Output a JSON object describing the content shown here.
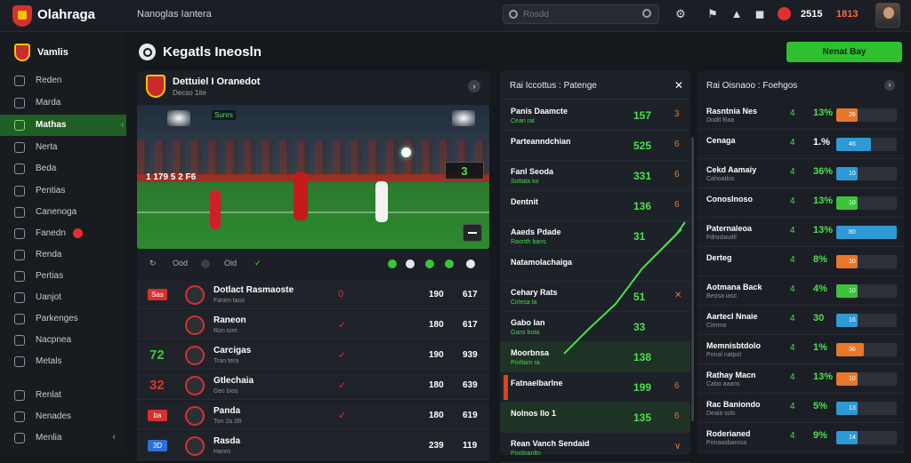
{
  "app": {
    "brand": "Olahraga",
    "topnav": "Nanoglas Iantera",
    "balance": "2515",
    "balance_sub": "1813"
  },
  "search": {
    "placeholder": "Rosdd"
  },
  "sidebar": {
    "header": "Vamlis",
    "items": [
      {
        "label": "Reden",
        "active": false
      },
      {
        "label": "Marda",
        "active": false
      },
      {
        "label": "Mathas",
        "active": true
      },
      {
        "label": "Nerta",
        "active": false
      },
      {
        "label": "Beda",
        "active": false
      },
      {
        "label": "Pentias",
        "active": false
      },
      {
        "label": "Canenoga",
        "active": false
      },
      {
        "label": "Fanedn",
        "active": false
      },
      {
        "label": "Renda",
        "active": false
      },
      {
        "label": "Pertias",
        "active": false
      },
      {
        "label": "Uanjot",
        "active": false
      },
      {
        "label": "Parkenges",
        "active": false
      },
      {
        "label": "Nacpnea",
        "active": false
      },
      {
        "label": "Metals",
        "active": false
      },
      {
        "label": "Renlat",
        "active": false
      },
      {
        "label": "Nenades",
        "active": false
      },
      {
        "label": "Menlia",
        "active": false
      }
    ]
  },
  "page": {
    "title": "Kegatls Ineosln",
    "cta": "Nenat Bay"
  },
  "match": {
    "title": "Dettuiel I Oranedot",
    "subtitle": "Decso 1ite",
    "video_tag": "Sunrs",
    "score_overlay": "1 179 5 2 F6",
    "live_value": "3",
    "controls": [
      "Ood",
      "Oid"
    ],
    "rows": [
      {
        "badge": "Sas",
        "badge_color": "#d6322b",
        "name": "Dotlact Rasmaoste",
        "sub": "Fanen taos",
        "mark": "0",
        "v1": "190",
        "v2": "617"
      },
      {
        "badge": "",
        "badge_color": "",
        "name": "Raneon",
        "sub": "Ron tore",
        "mark": "✓",
        "v1": "180",
        "v2": "617"
      },
      {
        "badge": "72",
        "badge_color": "#3ac43a",
        "name": "Carcigas",
        "sub": "Tran tera",
        "mark": "✓",
        "v1": "190",
        "v2": "939"
      },
      {
        "badge": "32",
        "badge_color": "#e03131",
        "name": "Gtlechaia",
        "sub": "Gec bios",
        "mark": "✓",
        "v1": "180",
        "v2": "639"
      },
      {
        "badge": "ba",
        "badge_color": "#d6322b",
        "name": "Panda",
        "sub": "Ton 2a 2B",
        "mark": "✓",
        "v1": "180",
        "v2": "619"
      },
      {
        "badge": "3D",
        "badge_color": "#2d6fd6",
        "name": "Rasda",
        "sub": "Hanro",
        "mark": "",
        "v1": "239",
        "v2": "119"
      }
    ]
  },
  "middle_panel": {
    "title": "Rai Iccottus : Patenge",
    "rows": [
      {
        "name": "Panis Daamcte",
        "sub": "Cean rat",
        "val": "157",
        "arr": "3"
      },
      {
        "name": "Parteanndchian",
        "sub": "",
        "val": "525",
        "arr": "6"
      },
      {
        "name": "Fanl Seoda",
        "sub": "Sottata ko",
        "val": "331",
        "arr": "6"
      },
      {
        "name": "Dentnit",
        "sub": "",
        "val": "136",
        "arr": "6"
      },
      {
        "name": "Aaeds Pdade",
        "sub": "Raonth bans",
        "val": "31",
        "arr": ""
      },
      {
        "name": "Natamolachaiga",
        "sub": "",
        "val": "",
        "arr": ""
      },
      {
        "name": "Cehary Rats",
        "sub": "Cirlesa ta",
        "val": "51",
        "arr": "✕"
      },
      {
        "name": "Gabo Ian",
        "sub": "Gans bota",
        "val": "33",
        "arr": ""
      },
      {
        "name": "Moorbnsa",
        "sub": "Porltarn ra",
        "val": "138",
        "arr": ""
      },
      {
        "name": "Fatnaelbarlne",
        "sub": "",
        "val": "199",
        "arr": "6"
      },
      {
        "name": "Nolnos Ilo 1",
        "sub": "",
        "val": "135",
        "arr": "6"
      },
      {
        "name": "Rean Vanch Sendaid",
        "sub": "Pordoanltn",
        "val": "",
        "arr": "∨"
      }
    ]
  },
  "right_panel": {
    "title": "Rai Oisnaoo : Foehgos",
    "rows": [
      {
        "name": "Rasntnia Nes",
        "sub": "Dodit Raa",
        "tick": "4",
        "pct": "13%",
        "bar": "26",
        "bar_color": "#e8772a",
        "pct_color": "#4ce04c"
      },
      {
        "name": "Cenaga",
        "sub": "",
        "tick": "4",
        "pct": "1.%",
        "bar": "46",
        "bar_color": "#2d9ad6",
        "pct_color": "#ffffff"
      },
      {
        "name": "Cekd Aamaiy",
        "sub": "Cahoatlos",
        "tick": "4",
        "pct": "36%",
        "bar": "10",
        "bar_color": "#2d9ad6",
        "pct_color": "#4ce04c"
      },
      {
        "name": "Conoslnoso",
        "sub": "",
        "tick": "4",
        "pct": "13%",
        "bar": "10",
        "bar_color": "#3ac43a",
        "pct_color": "#4ce04c"
      },
      {
        "name": "Paternaleoa",
        "sub": "Fdroslauitil",
        "tick": "4",
        "pct": "13%",
        "bar": "80",
        "bar_color": "#2d9ad6",
        "pct_color": "#4ce04c"
      },
      {
        "name": "Derteg",
        "sub": "",
        "tick": "4",
        "pct": "8%",
        "bar": "10",
        "bar_color": "#e8772a",
        "pct_color": "#4ce04c"
      },
      {
        "name": "Aotmana Back",
        "sub": "Beosa iasc",
        "tick": "4",
        "pct": "4%",
        "bar": "10",
        "bar_color": "#3ac43a",
        "pct_color": "#4ce04c"
      },
      {
        "name": "Aartecl Nnaie",
        "sub": "Cienna",
        "tick": "4",
        "pct": "30",
        "bar": "16",
        "bar_color": "#2d9ad6",
        "pct_color": "#4ce04c"
      },
      {
        "name": "Memnisbtdolo",
        "sub": "Ponal natpot",
        "tick": "4",
        "pct": "1%",
        "bar": "36",
        "bar_color": "#e8772a",
        "pct_color": "#4ce04c"
      },
      {
        "name": "Rathay Macn",
        "sub": "Cabo aaans",
        "tick": "4",
        "pct": "13%",
        "bar": "10",
        "bar_color": "#e8772a",
        "pct_color": "#4ce04c"
      },
      {
        "name": "Rac Baniondo",
        "sub": "Deaia sols",
        "tick": "4",
        "pct": "5%",
        "bar": "13",
        "bar_color": "#2d9ad6",
        "pct_color": "#4ce04c"
      },
      {
        "name": "Roderianed",
        "sub": "Ponaasbarosa",
        "tick": "4",
        "pct": "9%",
        "bar": "14",
        "bar_color": "#2d9ad6",
        "pct_color": "#4ce04c"
      }
    ]
  }
}
